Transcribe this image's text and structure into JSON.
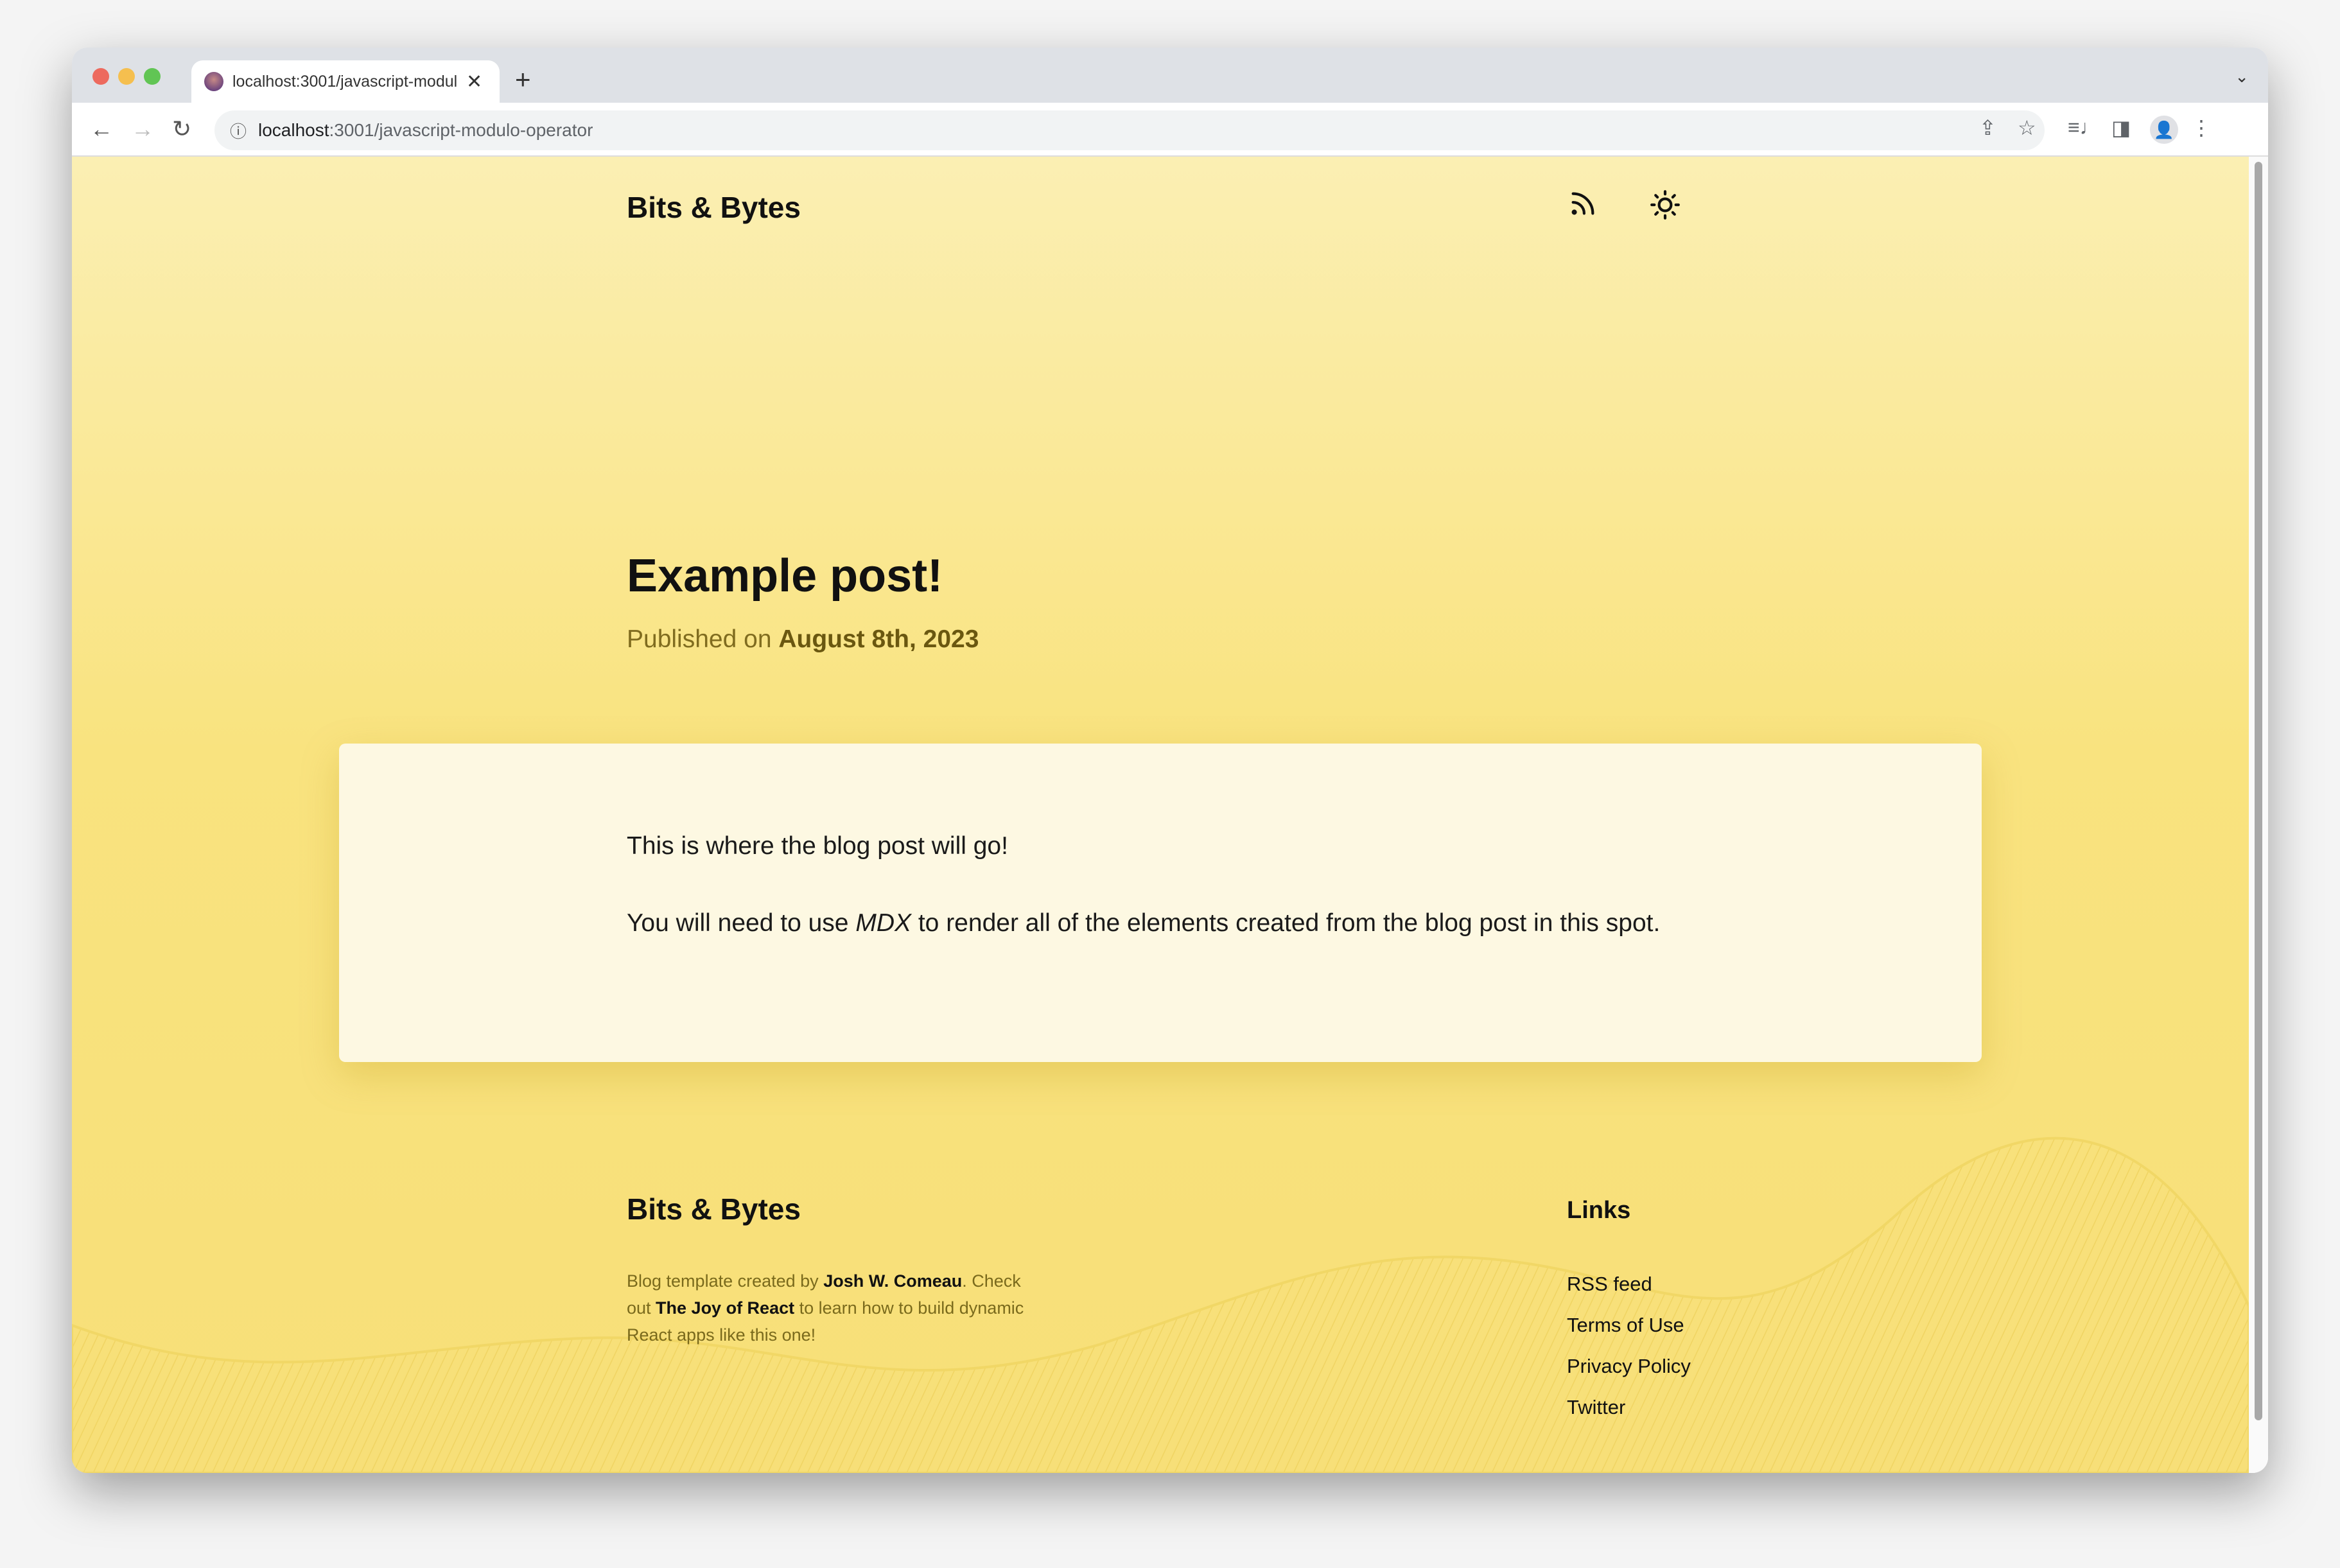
{
  "browser": {
    "tab_title": "localhost:3001/javascript-modulo-operator",
    "url_host": "localhost",
    "url_path": ":3001/javascript-modulo-operator",
    "icons": [
      "back-arrow",
      "forward-arrow",
      "reload",
      "info",
      "share",
      "star",
      "media-playlist",
      "side-panel",
      "profile",
      "kebab-menu"
    ]
  },
  "header": {
    "brand": "Bits & Bytes",
    "icons": [
      "rss-icon",
      "sun-icon"
    ]
  },
  "post": {
    "title": "Example post!",
    "published_prefix": "Published on",
    "published_date": "August 8th, 2023",
    "p1": "This is where the blog post will go!",
    "p2_a": "You will need to use ",
    "p2_em": "MDX",
    "p2_b": " to render all of the elements created from the blog post in this spot."
  },
  "footer": {
    "brand": "Bits & Bytes",
    "blurb_1": "Blog template created by ",
    "author": "Josh W. Comeau",
    "blurb_2": ". Check out ",
    "course": "The Joy of React",
    "blurb_3": " to learn how to build dynamic React apps like this one!",
    "links_heading": "Links",
    "links": [
      "RSS feed",
      "Terms of Use",
      "Privacy Policy",
      "Twitter"
    ]
  },
  "colors": {
    "background": "#f9e37f",
    "card": "#fdf8e2",
    "muted_text": "#806c1f"
  }
}
